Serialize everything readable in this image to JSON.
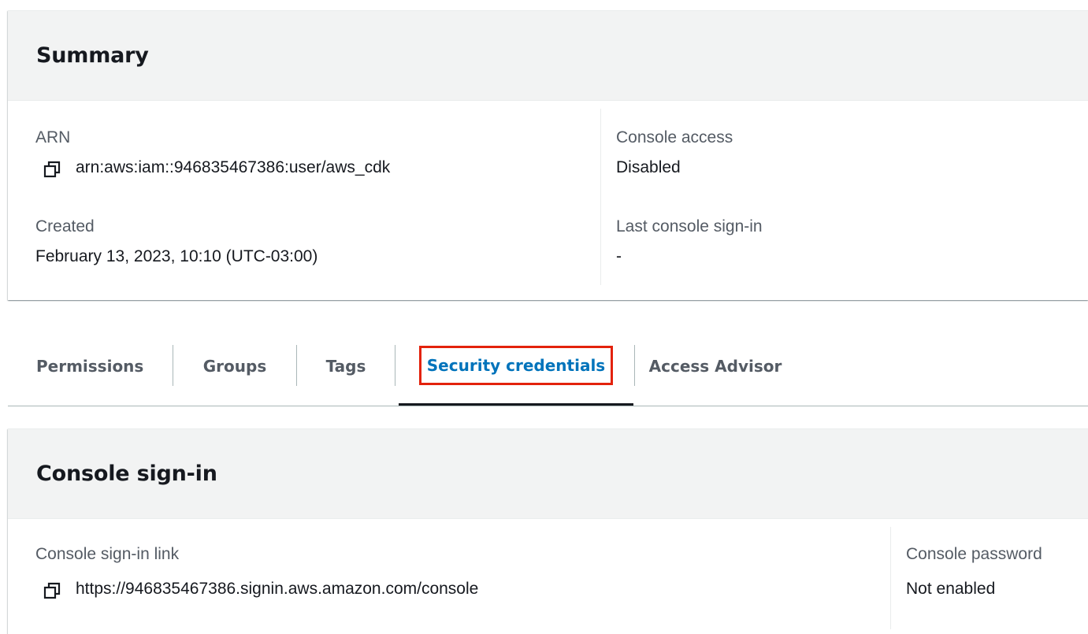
{
  "summary": {
    "title": "Summary",
    "arn_label": "ARN",
    "arn_value": "arn:aws:iam::946835467386:user/aws_cdk",
    "created_label": "Created",
    "created_value": "February 13, 2023, 10:10 (UTC-03:00)",
    "console_access_label": "Console access",
    "console_access_value": "Disabled",
    "last_signin_label": "Last console sign-in",
    "last_signin_value": "-"
  },
  "tabs": [
    {
      "label": "Permissions",
      "active": false
    },
    {
      "label": "Groups",
      "active": false
    },
    {
      "label": "Tags",
      "active": false
    },
    {
      "label": "Security credentials",
      "active": true
    },
    {
      "label": "Access Advisor",
      "active": false
    }
  ],
  "console_signin": {
    "title": "Console sign-in",
    "link_label": "Console sign-in link",
    "link_value": "https://946835467386.signin.aws.amazon.com/console",
    "password_label": "Console password",
    "password_value": "Not enabled"
  },
  "icons": {
    "copy": "copy-icon"
  },
  "colors": {
    "active_tab": "#0073bb",
    "highlight_box": "#e3220c",
    "header_bg": "#f2f3f3"
  }
}
